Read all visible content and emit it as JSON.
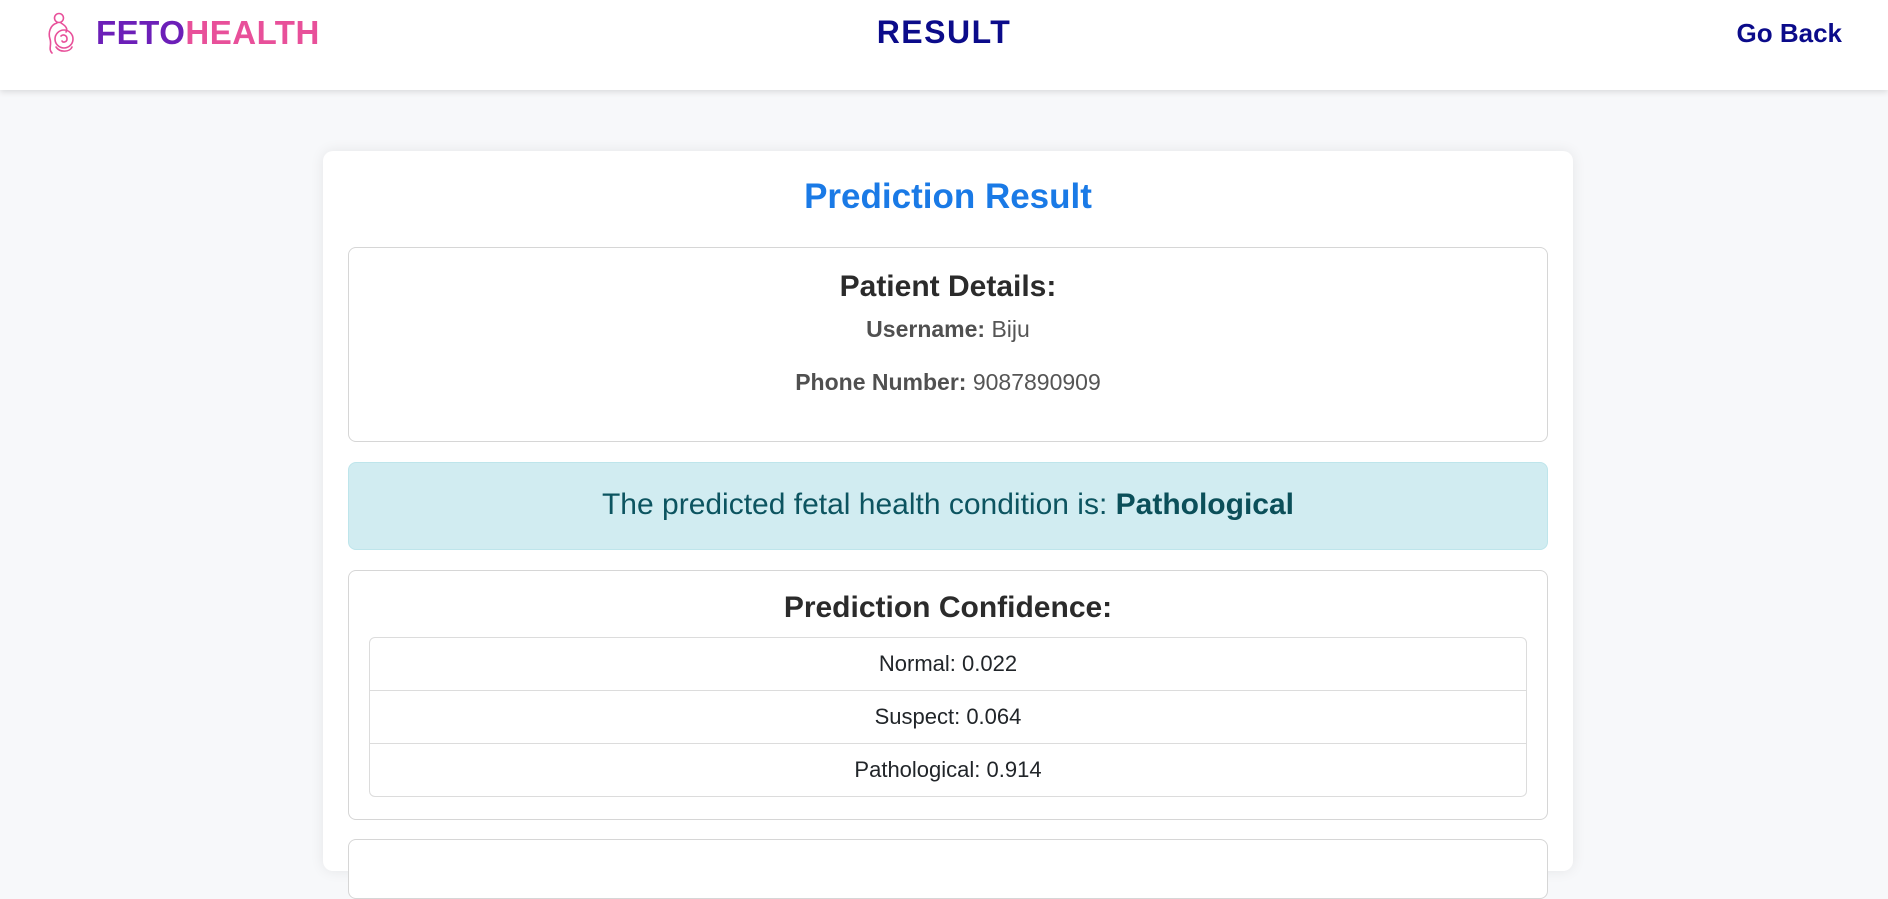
{
  "brand": {
    "name_part1": "FETO",
    "name_part2": "HEALTH",
    "color_part1": "#6c1fb8",
    "color_part2": "#e8509a",
    "icon": "pregnant-mother-icon"
  },
  "nav": {
    "title": "RESULT",
    "go_back_label": "Go Back"
  },
  "card": {
    "title": "Prediction Result",
    "patient_details": {
      "heading": "Patient Details:",
      "username_label": "Username:",
      "username_value": "Biju",
      "phone_label": "Phone Number:",
      "phone_value": "9087890909"
    },
    "prediction": {
      "text": "The predicted fetal health condition is:",
      "condition": "Pathological"
    },
    "confidence": {
      "heading": "Prediction Confidence:",
      "items": [
        {
          "label": "Normal: 0.022"
        },
        {
          "label": "Suspect: 0.064"
        },
        {
          "label": "Pathological: 0.914"
        }
      ]
    }
  },
  "colors": {
    "title_blue": "#1a7ae6",
    "nav_navy": "#0b0b8a",
    "alert_bg": "#d1ecf1"
  }
}
